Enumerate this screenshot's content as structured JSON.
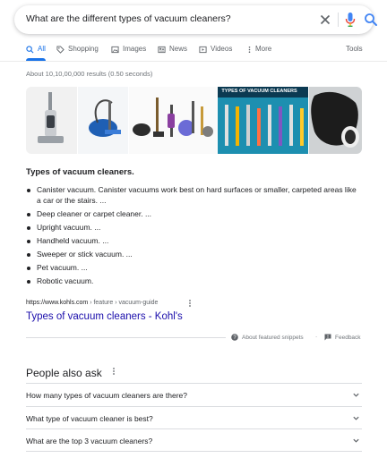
{
  "search": {
    "query": "What are the different types of vacuum cleaners?"
  },
  "tabs": [
    {
      "label": "All",
      "icon": "search-icon"
    },
    {
      "label": "Shopping",
      "icon": "tag-icon"
    },
    {
      "label": "Images",
      "icon": "image-icon"
    },
    {
      "label": "News",
      "icon": "news-icon"
    },
    {
      "label": "Videos",
      "icon": "video-icon"
    },
    {
      "label": "More",
      "icon": "more-vert-icon"
    }
  ],
  "tools_label": "Tools",
  "result_stats": "About 10,10,00,000 results (0.50 seconds)",
  "images": {
    "banner_text": "TYPES OF VACUUM CLEANERS"
  },
  "featured_snippet": {
    "title": "Types of vacuum cleaners.",
    "items": [
      "Canister vacuum. Canister vacuums work best on hard surfaces or smaller, carpeted areas like a car or the stairs. ...",
      "Deep cleaner or carpet cleaner. ...",
      "Upright vacuum. ...",
      "Handheld vacuum. ...",
      "Sweeper or stick vacuum. ...",
      "Pet vacuum. ...",
      "Robotic vacuum."
    ],
    "cite_domain": "https://www.kohls.com",
    "cite_path": " › feature › vacuum-guide",
    "link_text": "Types of vacuum cleaners - Kohl's",
    "about_label": "About featured snippets",
    "feedback_label": "Feedback"
  },
  "people_also_ask": {
    "title": "People also ask",
    "questions": [
      "How many types of vacuum cleaners are there?",
      "What type of vacuum cleaner is best?",
      "What are the top 3 vacuum cleaners?"
    ]
  },
  "colors": {
    "link": "#1a0dab",
    "accent": "#1a73e8"
  }
}
